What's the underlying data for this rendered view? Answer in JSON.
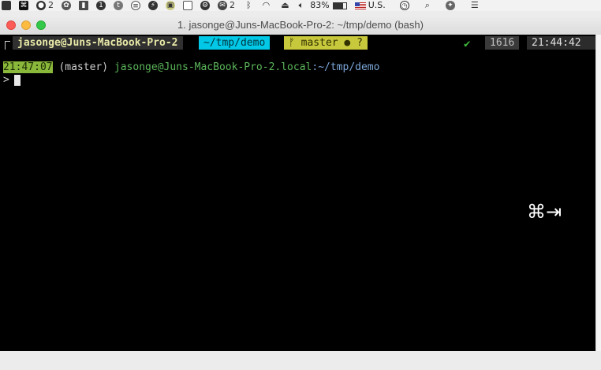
{
  "menubar": {
    "item_2a": "2",
    "item_2b": "2",
    "battery": "83%",
    "input_source": "U.S."
  },
  "window": {
    "title": "1. jasonge@Juns-MacBook-Pro-2: ~/tmp/demo (bash)"
  },
  "powerline": {
    "user": "jasonge@Juns-MacBook-Pro-2",
    "dir": "~/tmp/demo",
    "branch_glyph": "ᚠ",
    "branch": "master ● ?",
    "status": "✔",
    "history": "1616",
    "time": "21:44:42"
  },
  "prompt": {
    "clock": "21:47:07",
    "branch": "(master)",
    "host": "jasonge@Juns-MacBook-Pro-2.local",
    "sep": ":",
    "path": "~/tmp/demo",
    "caret": ">"
  },
  "overlay": {
    "shortcut": "⌘⇥"
  },
  "colors": {
    "terminal_bg": "#000000",
    "dir_segment": "#00c8e6",
    "git_segment": "#c8c83c",
    "clock_highlight": "#8ab83a",
    "host_green": "#5ab55a"
  }
}
